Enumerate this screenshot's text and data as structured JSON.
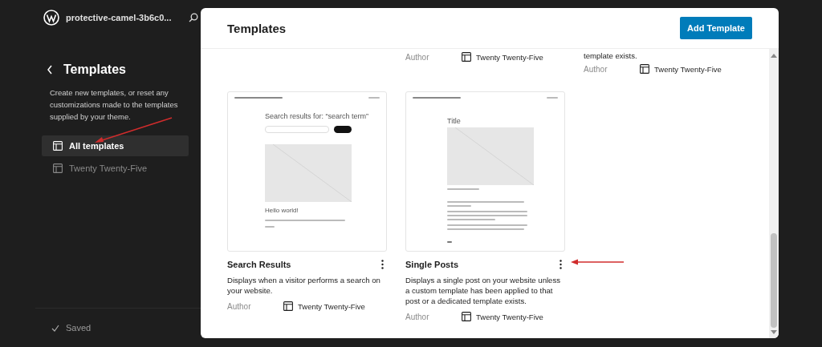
{
  "sidebar": {
    "site_title": "protective-camel-3b6c0...",
    "heading": "Templates",
    "description": "Create new templates, or reset any customizations made to the templates supplied by your theme.",
    "items": [
      {
        "label": "All templates",
        "selected": true
      },
      {
        "label": "Twenty Twenty-Five",
        "selected": false
      }
    ],
    "status": "Saved"
  },
  "panel": {
    "title": "Templates",
    "add_button": "Add Template",
    "partial_row": [
      {
        "author_label": "Author",
        "author": "Twenty Twenty-Five"
      },
      {
        "description": "template exists.",
        "author_label": "Author",
        "author": "Twenty Twenty-Five"
      }
    ],
    "templates": [
      {
        "title": "Search Results",
        "description": "Displays when a visitor performs a search on your website.",
        "author_label": "Author",
        "author": "Twenty Twenty-Five",
        "preview": {
          "kind": "search",
          "heading": "Search results for: “search term”",
          "post_title": "Hello world!"
        }
      },
      {
        "title": "Single Posts",
        "description": "Displays a single post on your website unless a custom template has been applied to that post or a dedicated template exists.",
        "author_label": "Author",
        "author": "Twenty Twenty-Five",
        "preview": {
          "kind": "single",
          "heading": "Title"
        }
      }
    ]
  }
}
